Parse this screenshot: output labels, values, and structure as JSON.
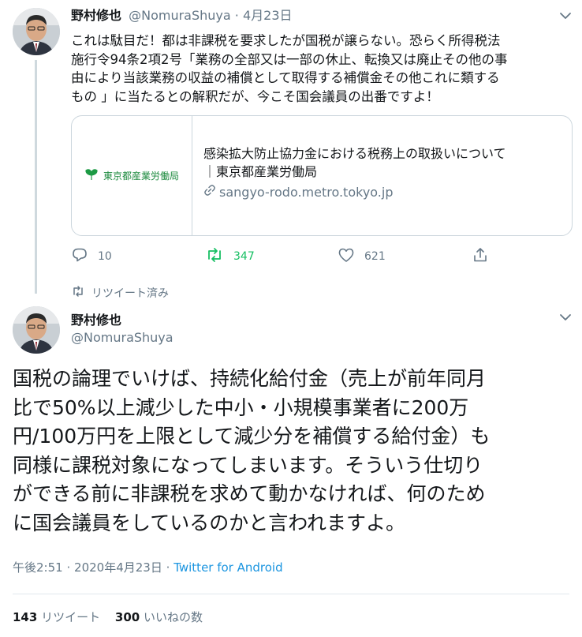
{
  "tweet1": {
    "name": "野村修也",
    "handle": "@NomuraShuya",
    "separator": "·",
    "date": "4月23日",
    "lines": [
      "これは駄目だ！都は非課税を要求したが国税が譲らない。恐らく所得税法",
      "施行令94条2項2号「業務の全部又は一部の休止、転換又は廃止その他の事",
      "由により当該業務の収益の補償として取得する補償金その他これに類する",
      "もの 」に当たるとの解釈だが、今こそ国会議員の出番ですよ！"
    ],
    "card": {
      "thumb_org": "東京都産業労働局",
      "title_lines": [
        "感染拡大防止協力金における税務上の取扱いについて",
        "｜東京都産業労働局"
      ],
      "domain": "sangyo-rodo.metro.tokyo.jp"
    },
    "actions": {
      "replies": "10",
      "retweets": "347",
      "likes": "621"
    },
    "retweeted_note": "リツイート済み"
  },
  "tweet2": {
    "name": "野村修也",
    "handle": "@NomuraShuya",
    "lines": [
      "国税の論理でいけば、持続化給付金（売上が前年同月",
      "比で50%以上減少した中小・小規模事業者に200万",
      "円/100万円を上限として減少分を補償する給付金）も",
      "同様に課税対象になってしまいます。そういう仕切り",
      "ができる前に非課税を求めて動かなければ、何のため",
      "に国会議員をしているのかと言われますよ。"
    ],
    "time": "午後2:51",
    "separator": "·",
    "date": "2020年4月23日",
    "client": "Twitter for Android",
    "retweets_count": "143",
    "retweets_label": "リツイート",
    "likes_count": "300",
    "likes_label": "いいねの数"
  },
  "colors": {
    "accent": "#1b95e0",
    "retweet_green": "#17bf63",
    "muted": "#657786",
    "border": "#ccd6dd"
  },
  "icons": [
    "chevron-down-icon",
    "reply-icon",
    "retweet-icon",
    "like-icon",
    "share-icon",
    "link-icon",
    "ginkgo-leaf-icon"
  ]
}
